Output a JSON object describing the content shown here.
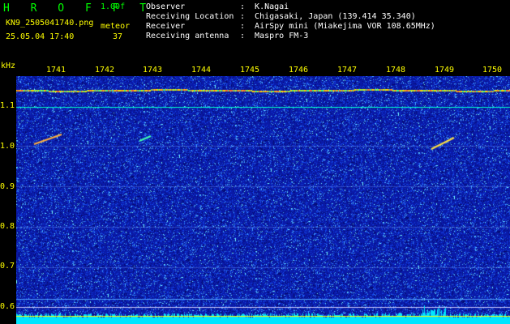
{
  "header": {
    "app_name": "H R O F F T",
    "version": "1.00f",
    "filename": "KN9_2505041740.png",
    "meteor_label": "meteor",
    "meteor_count": "37",
    "datetime": "25.05.04 17:40"
  },
  "station_info": {
    "rows": [
      {
        "label": "Observer",
        "value": ":  K.Nagai"
      },
      {
        "label": "Receiving Location",
        "value": ":  Chigasaki, Japan (139.414 35.340)"
      },
      {
        "label": "Receiver",
        "value": ":  AirSpy mini (Miakejima VOR 108.65MHz)"
      },
      {
        "label": "Receiving antenna",
        "value": ":  Maspro FM-3"
      }
    ]
  },
  "axes": {
    "y_unit": "kHz",
    "y_ticks": [
      "1.1",
      "1.0",
      "0.9",
      "0.8",
      "0.7",
      "0.6"
    ],
    "minute_labels": [
      "1741",
      "1742",
      "1743",
      "1744",
      "1745",
      "1746",
      "1747",
      "1748",
      "1749",
      "1750"
    ]
  },
  "colors": {
    "text_green": "#00ff00",
    "text_yellow": "#ffff00",
    "text_white": "#ffffff",
    "background": "#000000",
    "waterfall_base": "#0a1aa8",
    "noise_floor": "#00e5ff",
    "reference_line": "#00ffcc",
    "carrier": "#ffe000"
  }
}
